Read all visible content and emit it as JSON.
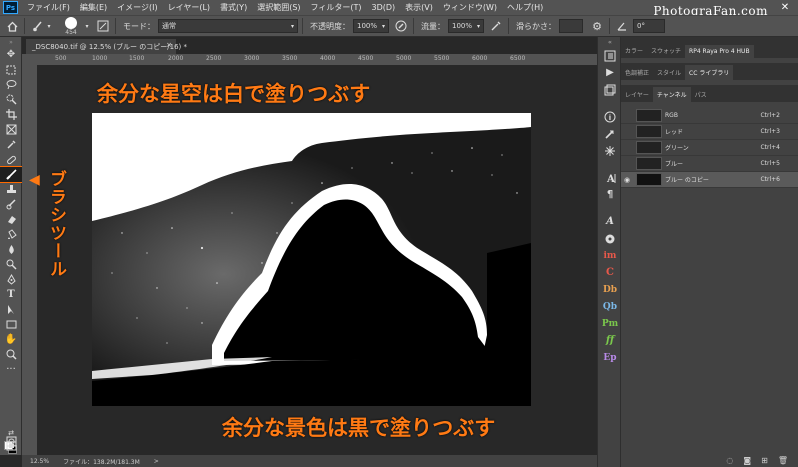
{
  "menu": {
    "logo": "Ps",
    "items": [
      "ファイル(F)",
      "編集(E)",
      "イメージ(I)",
      "レイヤー(L)",
      "書式(Y)",
      "選択範囲(S)",
      "フィルター(T)",
      "3D(D)",
      "表示(V)",
      "ウィンドウ(W)",
      "ヘルプ(H)"
    ],
    "brand": "PhotograFan.com",
    "close": "✕"
  },
  "options": {
    "brush_size": "454",
    "mode_label": "モード：",
    "mode_value": "通常",
    "opacity_label": "不透明度：",
    "opacity_value": "100%",
    "flow_label": "流量：",
    "flow_value": "100%",
    "smoothing_label": "滑らかさ：",
    "angle_value": "0°"
  },
  "document": {
    "tab_title": "_DSC8040.tif @ 12.5% (ブルー のコピー/16) *",
    "tab_close": "×"
  },
  "ruler": {
    "ticks": [
      "500",
      "1000",
      "1500",
      "2000",
      "2500",
      "3000",
      "3500",
      "4000",
      "4500",
      "5000",
      "5500",
      "6000",
      "6500"
    ]
  },
  "status": {
    "zoom": "12.5%",
    "file_info": "ファイル：138.2M/181.3M",
    "arrow": ">"
  },
  "panels": {
    "top_tabs": [
      "カラー",
      "スウォッチ",
      "RP4 Raya Pro 4 HUB"
    ],
    "mid_tabs": [
      "色調補正",
      "スタイル",
      "CC ライブラリ"
    ],
    "channel_tabs": [
      "レイヤー",
      "チャンネル",
      "パス"
    ],
    "channels": [
      {
        "name": "RGB",
        "shortcut": "Ctrl+2",
        "visible": false
      },
      {
        "name": "レッド",
        "shortcut": "Ctrl+3",
        "visible": false
      },
      {
        "name": "グリーン",
        "shortcut": "Ctrl+4",
        "visible": false
      },
      {
        "name": "ブルー",
        "shortcut": "Ctrl+5",
        "visible": false
      },
      {
        "name": "ブルー のコピー",
        "shortcut": "Ctrl+6",
        "visible": true
      }
    ]
  },
  "plugins": [
    "A",
    "im",
    "C",
    "Db",
    "Qb",
    "Pm",
    "ff",
    "Ep"
  ],
  "annotations": {
    "top": "余分な星空は白で塗りつぶす",
    "bottom": "余分な景色は黒で塗りつぶす",
    "side": "ブラシツール"
  },
  "colors": {
    "annotation": "#ff7a14",
    "plugin": "#e8584a",
    "plugin_green": "#7bc94c"
  }
}
